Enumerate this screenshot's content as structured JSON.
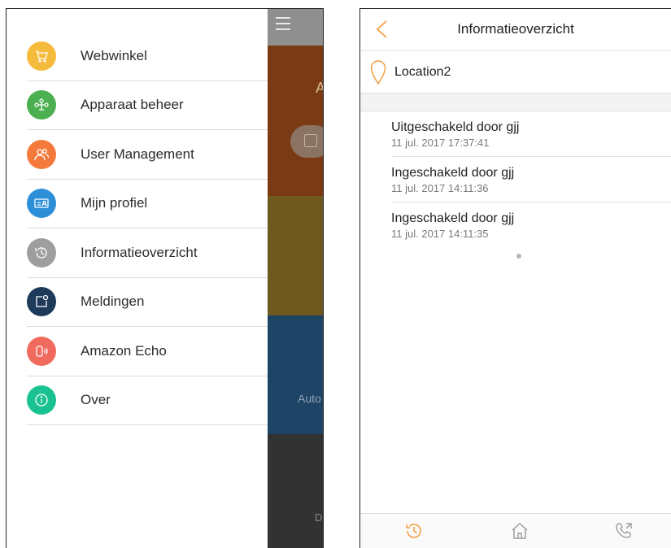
{
  "left_phone": {
    "menu_items": [
      {
        "label": "Webwinkel",
        "icon": "cart-icon",
        "color": "#f5bb3c"
      },
      {
        "label": "Apparaat beheer",
        "icon": "device-tree-icon",
        "color": "#4caf50"
      },
      {
        "label": "User Management",
        "icon": "users-icon",
        "color": "#f47a3c"
      },
      {
        "label": "Mijn profiel",
        "icon": "id-card-icon",
        "color": "#2d8fd8"
      },
      {
        "label": "Informatieoverzicht",
        "icon": "history-icon",
        "color": "#9e9e9e"
      },
      {
        "label": "Meldingen",
        "icon": "notification-icon",
        "color": "#1e3a5a"
      },
      {
        "label": "Amazon Echo",
        "icon": "echo-speaker-icon",
        "color": "#f06b5e"
      },
      {
        "label": "Over",
        "icon": "info-icon",
        "color": "#19c290"
      }
    ],
    "background_app": {
      "tile1_letter": "A",
      "tile3_text": "Auto",
      "tile4_text": "D"
    }
  },
  "right_phone": {
    "title": "Informatieoverzicht",
    "location": "Location2",
    "events": [
      {
        "title": "Uitgeschakeld door gjj",
        "time": "11 jul. 2017 17:37:41"
      },
      {
        "title": "Ingeschakeld door gjj",
        "time": "11 jul. 2017 14:11:36"
      },
      {
        "title": "Ingeschakeld door gjj",
        "time": "11 jul. 2017 14:11:35"
      }
    ],
    "accent_color": "#f39a3a",
    "tabs": [
      "history-icon",
      "home-icon",
      "call-icon"
    ]
  }
}
